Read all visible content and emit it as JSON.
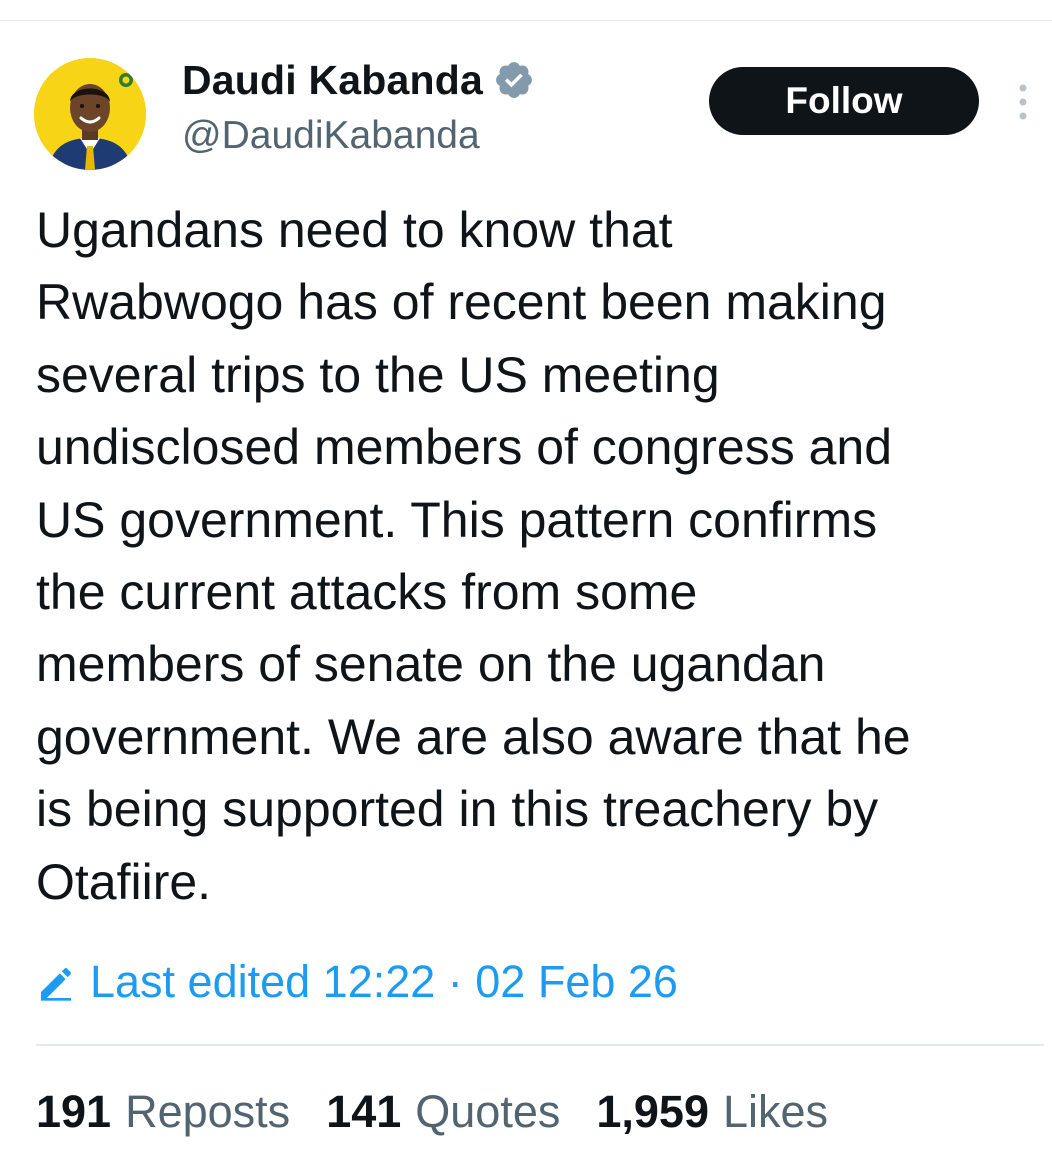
{
  "author": {
    "display_name": "Daudi Kabanda",
    "handle": "@DaudiKabanda",
    "verified": true,
    "verified_badge_color": "#829aab"
  },
  "follow_button": {
    "label": "Follow"
  },
  "tweet": {
    "lines": [
      "Ugandans need to know that",
      "Rwabwogo has of recent been making",
      "several trips to the US meeting",
      "undisclosed members of congress and",
      "US government. This pattern confirms",
      "the current attacks from some",
      "members of senate on the ugandan",
      "government. We are also aware that he",
      "is being supported in this treachery by",
      "Otafiire."
    ]
  },
  "edited": {
    "icon": "pencil-icon",
    "text": "Last edited 12:22 · 02 Feb 26",
    "color": "#1d9bf0"
  },
  "stats": {
    "reposts": {
      "count": "191",
      "label": "Reposts"
    },
    "quotes": {
      "count": "141",
      "label": "Quotes"
    },
    "likes": {
      "count": "1,959",
      "label": "Likes"
    }
  },
  "colors": {
    "text_primary": "#0f1419",
    "text_secondary": "#536471",
    "follow_bg": "#0f1419",
    "avatar_bg": "#f7d416"
  }
}
